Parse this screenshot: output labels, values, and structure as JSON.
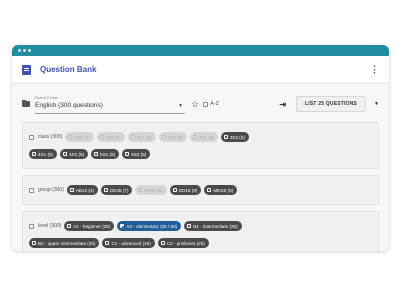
{
  "app": {
    "title": "Question Bank",
    "menu_icon": "more-vert-icon"
  },
  "folder": {
    "label": "Select Folder",
    "value": "English (300 questions)"
  },
  "toolbar": {
    "az_label": "A-Z",
    "list_button": "LIST 25 QUESTIONS"
  },
  "groups": [
    {
      "label": "class (300)",
      "chips": [
        {
          "text": "1S1 (5)",
          "state": "off"
        },
        {
          "text": "1S2 (5)",
          "state": "off"
        },
        {
          "text": "2S1 (5)",
          "state": "off"
        },
        {
          "text": "2S2 (5)",
          "state": "off"
        },
        {
          "text": "3S1 (5)",
          "state": "off"
        },
        {
          "text": "3S3 (5)",
          "state": "on"
        },
        {
          "text": "4S1 (5)",
          "state": "on"
        },
        {
          "text": "4S2 (5)",
          "state": "on"
        },
        {
          "text": "5S1 (5)",
          "state": "on"
        },
        {
          "text": "5S2 (5)",
          "state": "on"
        }
      ]
    },
    {
      "label": "group (300)",
      "chips": [
        {
          "text": "AB12 (4)",
          "state": "on"
        },
        {
          "text": "DE45 (7)",
          "state": "on"
        },
        {
          "text": "FR38 (2)",
          "state": "off"
        },
        {
          "text": "GD16 (8)",
          "state": "on"
        },
        {
          "text": "MESS (6)",
          "state": "on"
        }
      ]
    },
    {
      "label": "level (300)",
      "chips": [
        {
          "text": "A1 - beginner (25)",
          "state": "on"
        },
        {
          "text": "A2 - elementary (25 / 50)",
          "state": "sel"
        },
        {
          "text": "B1 - intermediate (25)",
          "state": "on"
        },
        {
          "text": "B2 - upper intermediate (25)",
          "state": "on"
        },
        {
          "text": "C1 - advanced (25)",
          "state": "on"
        },
        {
          "text": "C2 - proficient (25)",
          "state": "on"
        }
      ]
    }
  ],
  "colors": {
    "titlebar": "#1f8ea0",
    "accent": "#3f51b5",
    "chip_on": "#4a4a4a",
    "chip_selected": "#1f5e96",
    "chip_off": "#d6d6d6"
  }
}
